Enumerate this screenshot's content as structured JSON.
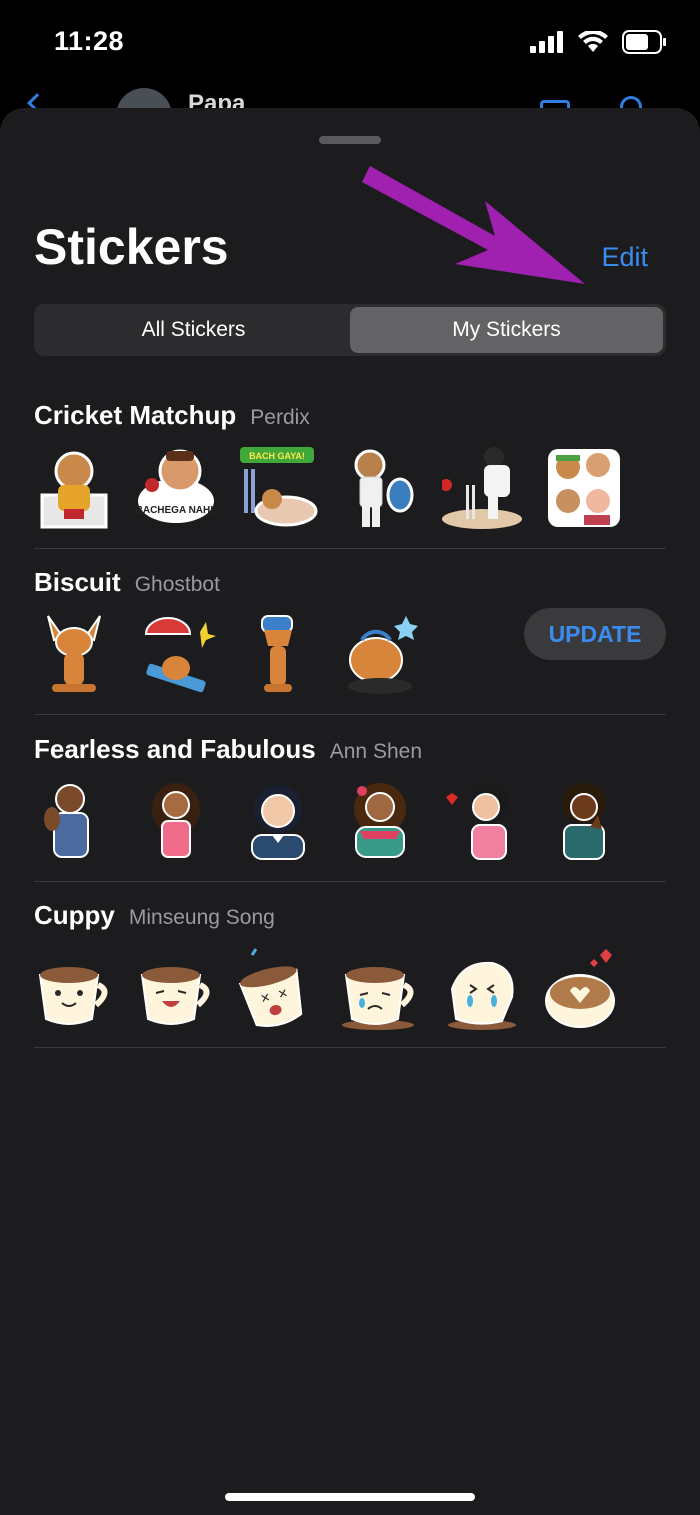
{
  "status": {
    "time": "11:28",
    "icons": [
      "signal-icon",
      "wifi-icon",
      "battery-icon"
    ]
  },
  "chat_peek": {
    "name": "Papa",
    "icons": [
      "back-chevron-icon",
      "video-call-icon",
      "phone-call-icon"
    ]
  },
  "sheet": {
    "title": "Stickers",
    "edit_label": "Edit"
  },
  "tabs": [
    {
      "label": "All Stickers",
      "active": false
    },
    {
      "label": "My Stickers",
      "active": true
    }
  ],
  "packs": [
    {
      "name": "Cricket Matchup",
      "author": "Perdix",
      "stickers": [
        "cricket-fan-sticker",
        "bachega-nahi-sticker",
        "bach-gaya-sticker",
        "batsman-sticker",
        "wicket-sticker",
        "cricket-crowd-sticker"
      ],
      "sticker_texts": {
        "1": "BACHEGA NAHI!",
        "2": "BACH GAYA!"
      }
    },
    {
      "name": "Biscuit",
      "author": "Ghostbot",
      "stickers": [
        "corgi-sitting-sticker",
        "corgi-beach-sticker",
        "corgi-telephone-sticker",
        "corgi-dj-sticker"
      ],
      "update_label": "UPDATE"
    },
    {
      "name": "Fearless and Fabulous",
      "author": "Ann Shen",
      "stickers": [
        "woman-flexing-sticker",
        "woman-hands-hips-sticker",
        "woman-laughing-sticker",
        "woman-hearts-sticker",
        "woman-blowing-kiss-sticker",
        "woman-praying-sticker"
      ]
    },
    {
      "name": "Cuppy",
      "author": "Minseung Song",
      "stickers": [
        "cup-smiling-sticker",
        "cup-laughing-sticker",
        "cup-dizzy-sticker",
        "cup-sad-sticker",
        "cup-crying-sticker",
        "cup-latte-heart-sticker"
      ]
    }
  ],
  "colors": {
    "accent": "#3b8cf0",
    "sheet_bg": "#1c1c1e",
    "arrow": "#a020b0"
  }
}
